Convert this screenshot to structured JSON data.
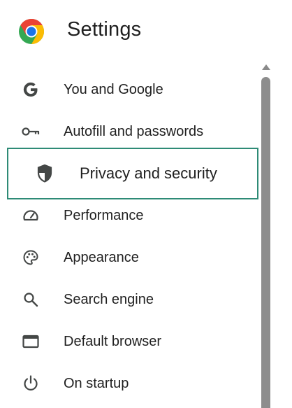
{
  "header": {
    "title": "Settings",
    "logo_icon": "chrome-logo-icon"
  },
  "nav": {
    "items": [
      {
        "label": "You and Google",
        "icon": "google-g-icon"
      },
      {
        "label": "Autofill and passwords",
        "icon": "key-icon"
      },
      {
        "label": "Privacy and security",
        "icon": "shield-icon",
        "selected": true
      },
      {
        "label": "Performance",
        "icon": "speedometer-icon"
      },
      {
        "label": "Appearance",
        "icon": "palette-icon"
      },
      {
        "label": "Search engine",
        "icon": "search-icon"
      },
      {
        "label": "Default browser",
        "icon": "browser-window-icon"
      },
      {
        "label": "On startup",
        "icon": "power-icon"
      }
    ]
  },
  "colors": {
    "selection_border": "#2e8b76",
    "text": "#1f1f1f",
    "icon": "#444746",
    "scrollbar": "#8d8d8d"
  }
}
